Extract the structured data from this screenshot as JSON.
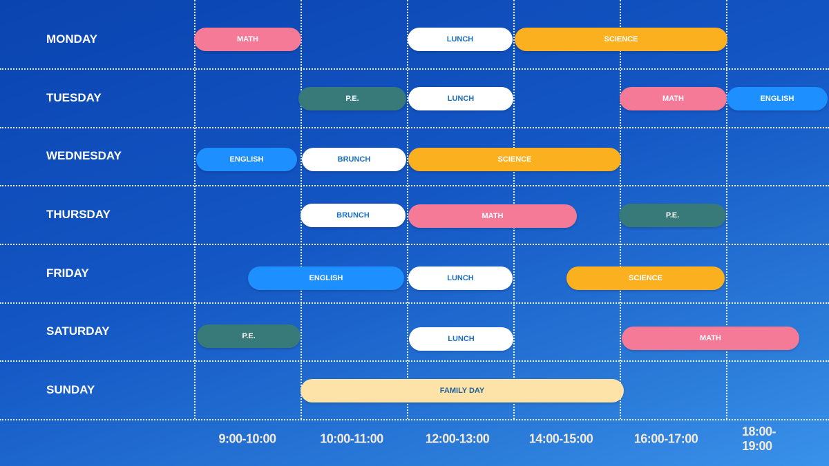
{
  "days": [
    "MONDAY",
    "TUESDAY",
    "WEDNESDAY",
    "THURSDAY",
    "FRIDAY",
    "SATURDAY",
    "SUNDAY"
  ],
  "time_slots": [
    "9:00-10:00",
    "10:00-11:00",
    "12:00-13:00",
    "14:00-15:00",
    "16:00-17:00",
    "18:00-19:00"
  ],
  "colors": {
    "MATH": "#f47a97",
    "P.E.": "#387a7a",
    "LUNCH": "#ffffff",
    "BRUNCH": "#ffffff",
    "SCIENCE": "#fbb01f",
    "ENGLISH": "#1e8fff",
    "FAMILY DAY": "#fde3a7"
  },
  "events": [
    {
      "day": "MONDAY",
      "label": "MATH",
      "style": "pink"
    },
    {
      "day": "MONDAY",
      "label": "LUNCH",
      "style": "white"
    },
    {
      "day": "MONDAY",
      "label": "SCIENCE",
      "style": "orange"
    },
    {
      "day": "TUESDAY",
      "label": "P.E.",
      "style": "teal"
    },
    {
      "day": "TUESDAY",
      "label": "LUNCH",
      "style": "white"
    },
    {
      "day": "TUESDAY",
      "label": "MATH",
      "style": "pink"
    },
    {
      "day": "TUESDAY",
      "label": "ENGLISH",
      "style": "blue"
    },
    {
      "day": "WEDNESDAY",
      "label": "ENGLISH",
      "style": "blue"
    },
    {
      "day": "WEDNESDAY",
      "label": "BRUNCH",
      "style": "white"
    },
    {
      "day": "WEDNESDAY",
      "label": "SCIENCE",
      "style": "orange"
    },
    {
      "day": "THURSDAY",
      "label": "BRUNCH",
      "style": "white"
    },
    {
      "day": "THURSDAY",
      "label": "MATH",
      "style": "pink"
    },
    {
      "day": "THURSDAY",
      "label": "P.E.",
      "style": "teal"
    },
    {
      "day": "FRIDAY",
      "label": "ENGLISH",
      "style": "blue"
    },
    {
      "day": "FRIDAY",
      "label": "LUNCH",
      "style": "white"
    },
    {
      "day": "FRIDAY",
      "label": "SCIENCE",
      "style": "orange"
    },
    {
      "day": "SATURDAY",
      "label": "P.E.",
      "style": "teal"
    },
    {
      "day": "SATURDAY",
      "label": "LUNCH",
      "style": "white"
    },
    {
      "day": "SATURDAY",
      "label": "MATH",
      "style": "pink"
    },
    {
      "day": "SUNDAY",
      "label": "FAMILY DAY",
      "style": "cream"
    }
  ]
}
